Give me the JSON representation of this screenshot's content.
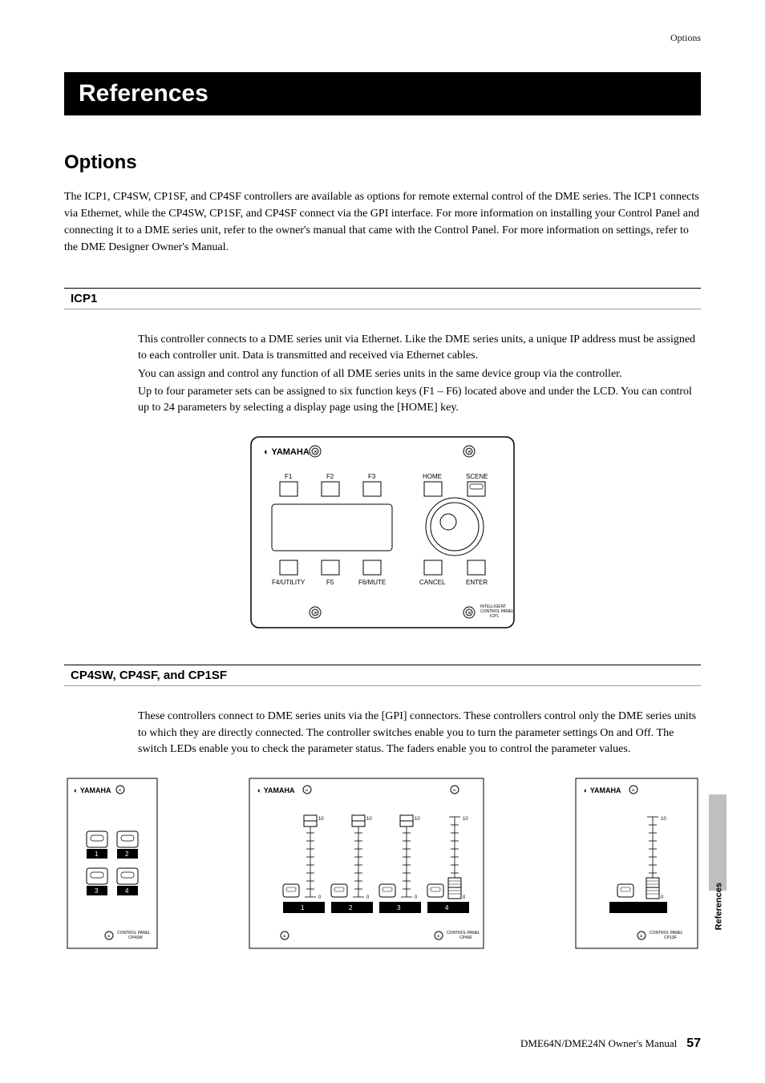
{
  "header": {
    "right_label": "Options"
  },
  "title": "References",
  "section": {
    "title": "Options",
    "intro": "The ICP1, CP4SW, CP1SF, and CP4SF controllers are available as options for remote external control of the DME series. The ICP1 connects via Ethernet, while the CP4SW, CP1SF, and CP4SF connect via the GPI interface. For more information on installing your Control Panel and connecting it to a DME series unit, refer to the owner's manual that came with the Control Panel. For more information on settings, refer to the DME Designer Owner's Manual."
  },
  "icp1": {
    "title": "ICP1",
    "p1": "This controller connects to a DME series unit via Ethernet. Like the DME series units, a unique IP address must be assigned to each controller unit. Data is transmitted and received via Ethernet cables.",
    "p2": "You can assign and control any function of all DME series units in the same device group via the controller.",
    "p3": "Up to four parameter sets can be assigned to six function keys (F1 – F6) located above and under the LCD. You can control up to 24 parameters by selecting a display page using the [HOME] key.",
    "panel": {
      "brand": "YAMAHA",
      "keys_top": [
        "F1",
        "F2",
        "F3"
      ],
      "keys_right": [
        "HOME",
        "SCENE"
      ],
      "keys_bottom": [
        "F4/UTILITY",
        "F5",
        "F6/MUTE",
        "CANCEL",
        "ENTER"
      ],
      "model_label": "INTELLIGENT CONTROL PANEL ICP1"
    }
  },
  "cp": {
    "title": "CP4SW, CP4SF, and CP1SF",
    "p1": "These controllers connect to DME series units via the [GPI] connectors. These controllers control only the DME series units to which they are directly connected. The controller switches enable you to turn the parameter settings On and Off. The switch LEDs enable you to check the parameter status. The faders enable you to control the parameter values.",
    "brand": "YAMAHA",
    "cp4sw": {
      "labels": [
        "1",
        "2",
        "3",
        "4"
      ],
      "model": "CONTROL PANEL CP4SW"
    },
    "cp4sf": {
      "labels": [
        "1",
        "2",
        "3",
        "4"
      ],
      "scale_top": "10",
      "scale_bottom": "0",
      "model": "CONTROL PANEL CP4SF"
    },
    "cp1sf": {
      "scale_top": "10",
      "scale_bottom": "0",
      "model": "CONTROL PANEL CP1SF"
    }
  },
  "side_tab": "References",
  "footer": {
    "manual": "DME64N/DME24N Owner's Manual",
    "page": "57"
  }
}
